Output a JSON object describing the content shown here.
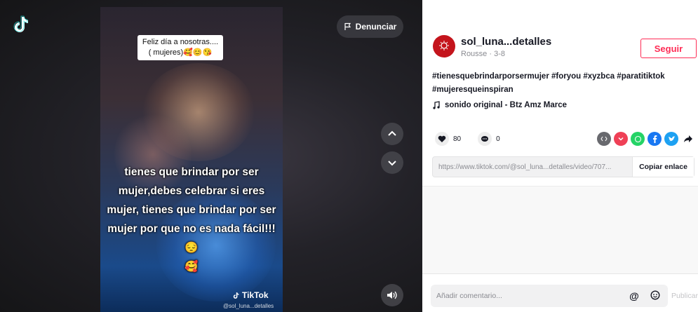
{
  "video": {
    "report_label": "Denunciar",
    "caption_line1": "Feliz día a nosotras....",
    "caption_line2": "( mujeres)🥰😊😘",
    "overlay_text": "tienes que brindar por ser mujer,debes celebrar si eres mujer, tienes que brindar por ser mujer por que no es nada fácil!!!😔",
    "overlay_emoji": "🥰",
    "watermark": "TikTok",
    "watermark_user": "@sol_luna...detalles"
  },
  "author": {
    "username": "sol_luna...detalles",
    "subline": "Rousse · 3-8",
    "follow_label": "Seguir"
  },
  "description": "#tienesquebrindarporsermujer #foryou #xyzbca #paratitiktok #mujeresqueinspiran",
  "music": "sonido original - Btz Amz Marce",
  "stats": {
    "likes": "80",
    "comments": "0"
  },
  "share_icons": [
    "embed-icon",
    "pocket-icon",
    "whatsapp-icon",
    "facebook-icon",
    "twitter-icon",
    "forward-icon"
  ],
  "link": {
    "url": "https://www.tiktok.com/@sol_luna...detalles/video/707...",
    "copy_label": "Copiar enlace"
  },
  "comment": {
    "placeholder": "Añadir comentario...",
    "publish_label": "Publicar"
  },
  "colors": {
    "accent": "#fe2c55",
    "avatar": "#c4141c"
  }
}
